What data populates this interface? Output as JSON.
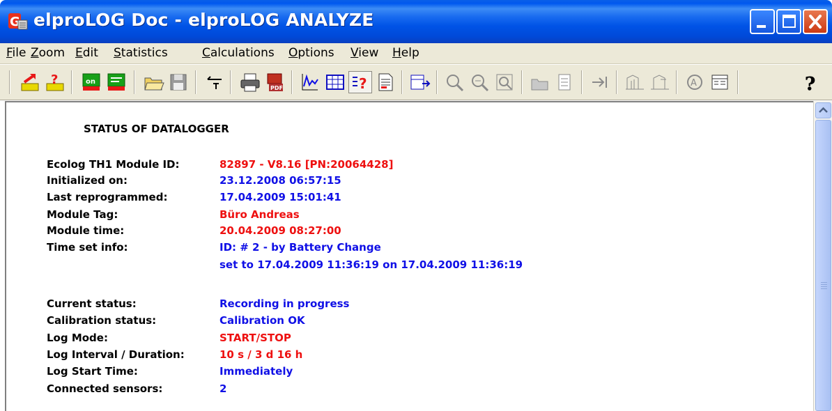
{
  "window": {
    "title": "elproLOG Doc - elproLOG ANALYZE",
    "colors": {
      "titlebar": "#0058ee",
      "close": "#cc3a14"
    }
  },
  "menu": [
    "File",
    "Zoom",
    "Edit",
    "Statistics",
    "Calculations",
    "Options",
    "View",
    "Help"
  ],
  "toolbar": {
    "icons": [
      "download-icon",
      "download-query-icon",
      "logger-green-icon",
      "logger-program-icon",
      "open-folder-icon",
      "save-icon",
      "edit-icon",
      "print-icon",
      "pdf-icon",
      "chart-icon",
      "table-icon",
      "status-icon",
      "report-icon",
      "export-icon",
      "zoom-icon",
      "zoom-area-icon",
      "zoom-reset-icon",
      "open-data-icon",
      "list-icon",
      "next-icon",
      "graph-prev-icon",
      "graph-next-icon",
      "annotate-icon",
      "properties-icon",
      "help-icon"
    ]
  },
  "status": {
    "heading": "STATUS OF DATALOGGER",
    "rows": [
      {
        "label": "Ecolog TH1  Module ID:",
        "value": "82897  - V8.16 [PN:20064428]",
        "color": "red"
      },
      {
        "label": "Initialized on:",
        "value": "23.12.2008  06:57:15",
        "color": "blue"
      },
      {
        "label": "Last reprogrammed:",
        "value": "17.04.2009  15:01:41",
        "color": "blue"
      },
      {
        "label": "Module Tag:",
        "value": "Büro Andreas",
        "color": "red"
      },
      {
        "label": "Module time:",
        "value": "20.04.2009  08:27:00",
        "color": "red"
      },
      {
        "label": "Time set info:",
        "value": "ID:  # 2 - by Battery Change",
        "color": "blue"
      },
      {
        "label": "",
        "value": "set to 17.04.2009  11:36:19 on 17.04.2009  11:36:19",
        "color": "blue"
      },
      {
        "label": "Current status:",
        "value": "Recording in progress",
        "color": "blue"
      },
      {
        "label": "Calibration status:",
        "value": "Calibration OK",
        "color": "blue"
      },
      {
        "label": "Log Mode:",
        "value": "START/STOP",
        "color": "red"
      },
      {
        "label": "Log Interval / Duration:",
        "value": "10 s / 3 d  16 h",
        "color": "red"
      },
      {
        "label": "Log Start Time:",
        "value": "Immediately",
        "color": "blue"
      },
      {
        "label": "Connected sensors:",
        "value": "2",
        "color": "blue"
      }
    ]
  }
}
